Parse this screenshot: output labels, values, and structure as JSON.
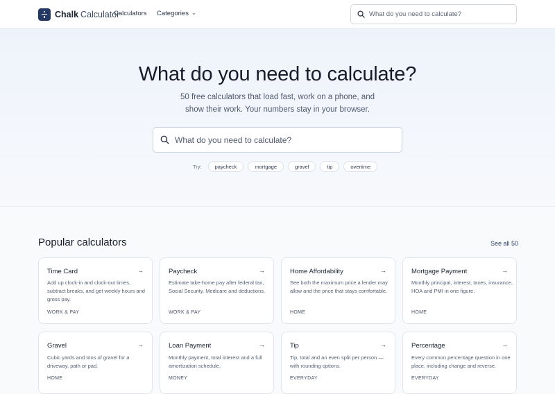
{
  "header": {
    "brand_name": "Chalk",
    "brand_sub": "Calculator",
    "nav_calculators": "Calculators",
    "nav_categories": "Categories",
    "search_placeholder": "What do you need to calculate?"
  },
  "hero": {
    "title": "What do you need to calculate?",
    "subtitle_line1": "50 free calculators that load fast, work on a phone, and",
    "subtitle_line2": "show their work. Your numbers stay in your browser.",
    "search_placeholder": "What do you need to calculate?",
    "try_label": "Try:",
    "suggestions": [
      "paycheck",
      "mortgage",
      "gravel",
      "tip",
      "overtime"
    ]
  },
  "popular": {
    "title": "Popular calculators",
    "see_all": "See all 50",
    "cards": [
      {
        "title": "Time Card",
        "desc": "Add up clock-in and clock-out times, subtract breaks, and get weekly hours and gross pay.",
        "category": "WORK & PAY"
      },
      {
        "title": "Paycheck",
        "desc": "Estimate take-home pay after federal tax, Social Security, Medicare and deductions.",
        "category": "WORK & PAY"
      },
      {
        "title": "Home Affordability",
        "desc": "See both the maximum price a lender may allow and the price that stays comfortable.",
        "category": "HOME"
      },
      {
        "title": "Mortgage Payment",
        "desc": "Monthly principal, interest, taxes, insurance, HOA and PMI in one figure.",
        "category": "HOME"
      },
      {
        "title": "Gravel",
        "desc": "Cubic yards and tons of gravel for a driveway, path or pad.",
        "category": "HOME"
      },
      {
        "title": "Loan Payment",
        "desc": "Monthly payment, total interest and a full amortization schedule.",
        "category": "MONEY"
      },
      {
        "title": "Tip",
        "desc": "Tip, total and an even split per person — with rounding options.",
        "category": "EVERYDAY"
      },
      {
        "title": "Percentage",
        "desc": "Every common percentage question in one place, including change and reverse.",
        "category": "EVERYDAY"
      }
    ]
  },
  "icons": {
    "logo": "calculator-divide-icon",
    "search": "search-icon",
    "chevron": "chevron-down-icon",
    "arrow": "arrow-right-icon"
  },
  "colors": {
    "brand": "#243a64",
    "link": "#2c3e66",
    "hero_bg": "#eef3fb"
  }
}
